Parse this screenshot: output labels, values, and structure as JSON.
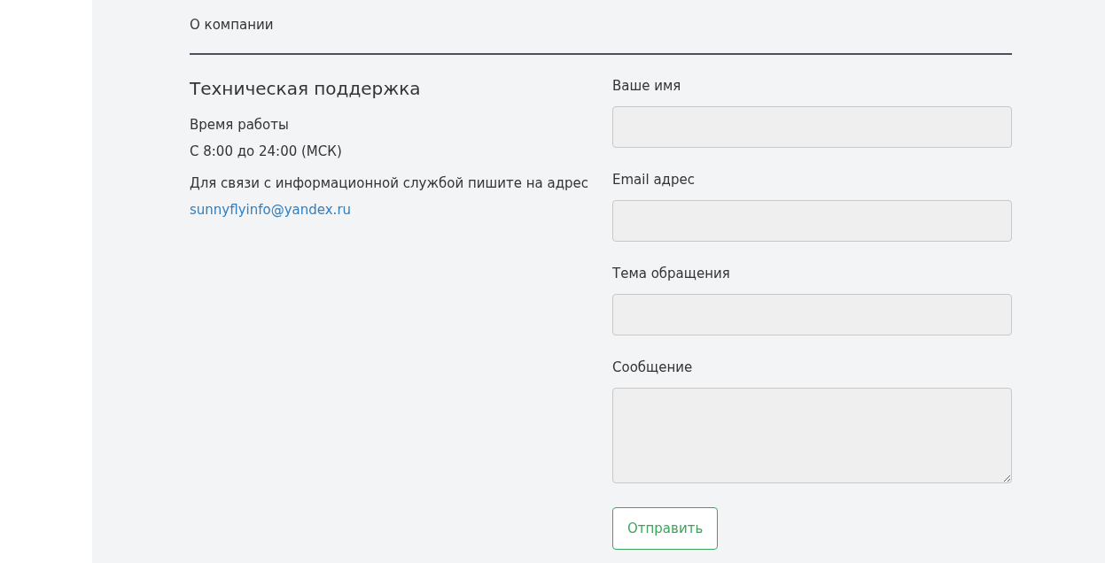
{
  "nav": {
    "link": "О компании"
  },
  "support": {
    "title": "Техническая поддержка",
    "hours_label": "Время работы",
    "hours": "С 8:00 до 24:00 (МСК)",
    "contact_text": "Для связи с информационной службой пишите на адрес",
    "email": "sunnyflyinfo@yandex.ru"
  },
  "form": {
    "fields": [
      {
        "label": "Ваше имя",
        "kind": "input"
      },
      {
        "label": "Email адрес",
        "kind": "input"
      },
      {
        "label": "Тема обращения",
        "kind": "input"
      },
      {
        "label": "Сообщение",
        "kind": "textarea"
      }
    ],
    "submit": "Отправить"
  }
}
